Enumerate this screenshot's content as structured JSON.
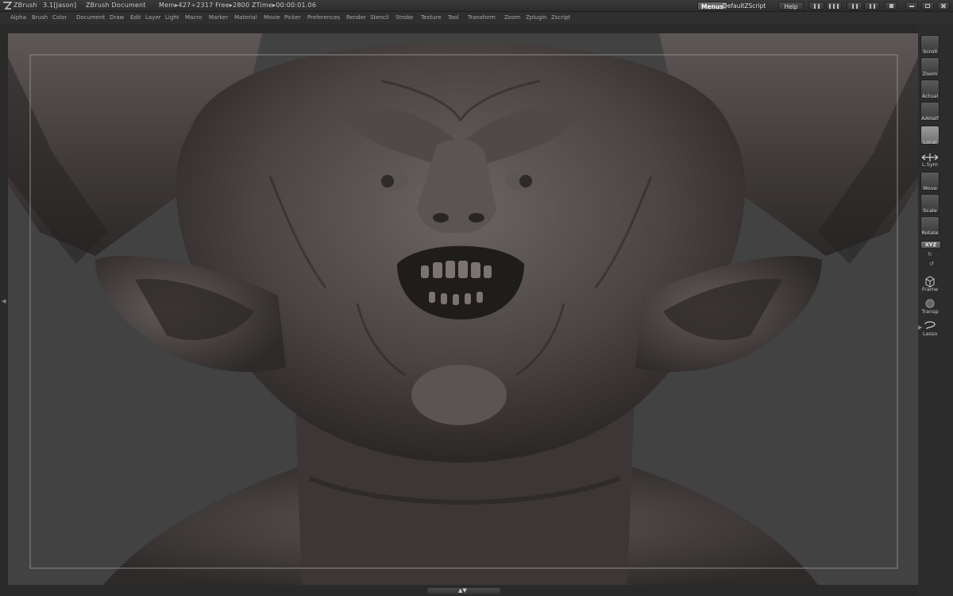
{
  "titlebar": {
    "app": "ZBrush",
    "version": "3.1[Jason]",
    "document": "ZBrush Document",
    "mem": "Mem▸427÷2317  Free▸2800  ZTime▸00:00:01.06",
    "buttons": {
      "menus": "Menus",
      "script": "DefaultZScript",
      "help": "Help"
    }
  },
  "menubar": {
    "items": [
      "Alpha",
      "Brush",
      "Color",
      "Document",
      "Draw",
      "Edit",
      "Layer",
      "Light",
      "Macro",
      "Marker",
      "Material",
      "Movie",
      "Picker",
      "Preferences",
      "Render",
      "Stencil",
      "Stroke",
      "Texture",
      "Tool",
      "Transform",
      "Zoom",
      "Zplugin",
      "Zscript"
    ]
  },
  "right_tools": {
    "scroll": "Scroll",
    "zoom": "Zoom",
    "actual": "Actual",
    "aahalf": "AAHalf",
    "local": "Local",
    "lsym": "L.Sym",
    "move": "Move",
    "scale": "Scale",
    "rotate": "Rotate",
    "xyz": "XYZ",
    "frame": "Frame",
    "transp": "Transp",
    "lasso": "Lasso"
  },
  "colors": {
    "accent": "#6a6a6a",
    "background": "#424242",
    "panel": "#2c2c2c"
  }
}
